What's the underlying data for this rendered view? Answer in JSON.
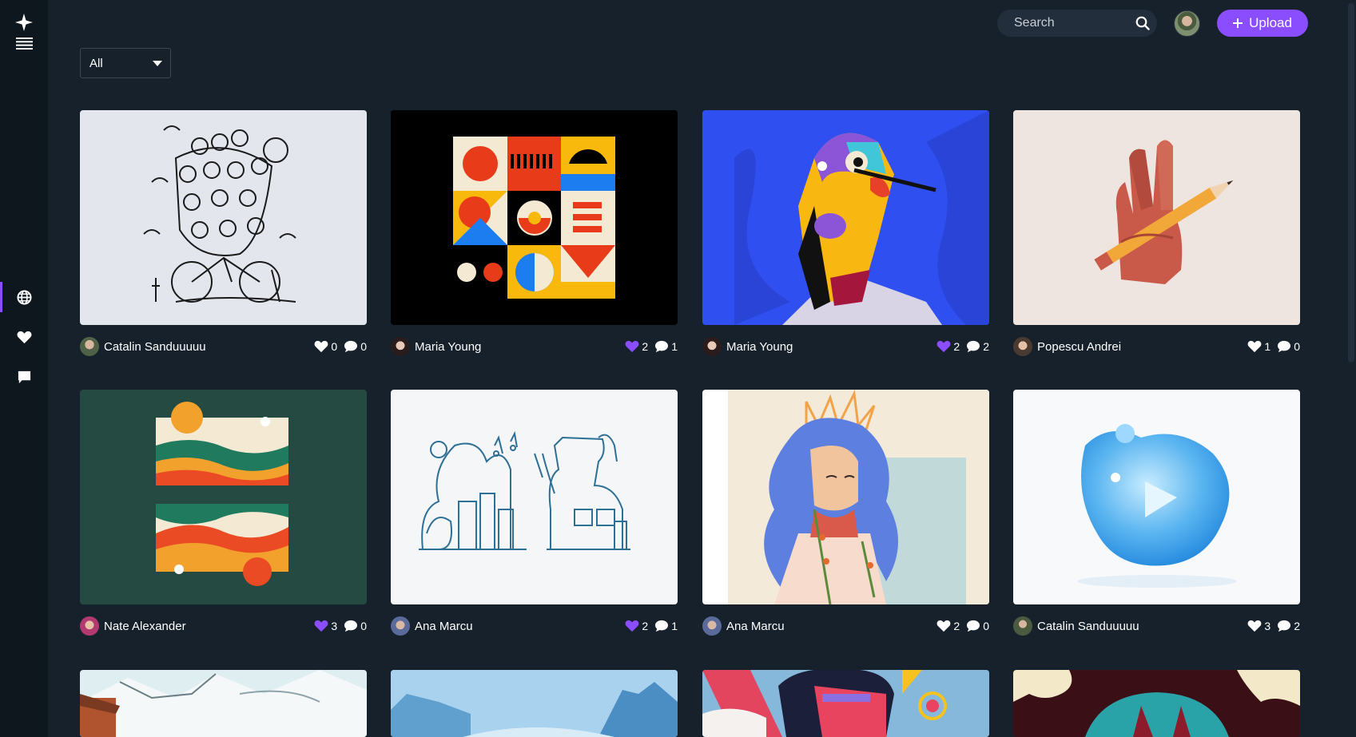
{
  "search": {
    "placeholder": "Search"
  },
  "toolbar": {
    "upload_label": "Upload"
  },
  "filter": {
    "selected": "All"
  },
  "sidebar": {
    "items": [
      {
        "icon": "globe-icon",
        "active": true
      },
      {
        "icon": "heart-icon",
        "active": false
      },
      {
        "icon": "chat-icon",
        "active": false
      }
    ]
  },
  "colors": {
    "accent": "#8a4dff",
    "background": "#17212b",
    "sidebar": "#0e161e"
  },
  "cards": [
    {
      "author": "Catalin Sanduuuuu",
      "likes": "0",
      "comments": "0",
      "liked": false
    },
    {
      "author": "Maria Young",
      "likes": "2",
      "comments": "1",
      "liked": true
    },
    {
      "author": "Maria Young",
      "likes": "2",
      "comments": "2",
      "liked": true
    },
    {
      "author": "Popescu Andrei",
      "likes": "1",
      "comments": "0",
      "liked": false
    },
    {
      "author": "Nate Alexander",
      "likes": "3",
      "comments": "0",
      "liked": true
    },
    {
      "author": "Ana Marcu",
      "likes": "2",
      "comments": "1",
      "liked": true
    },
    {
      "author": "Ana Marcu",
      "likes": "2",
      "comments": "0",
      "liked": false
    },
    {
      "author": "Catalin Sanduuuuu",
      "likes": "3",
      "comments": "2",
      "liked": false
    }
  ]
}
